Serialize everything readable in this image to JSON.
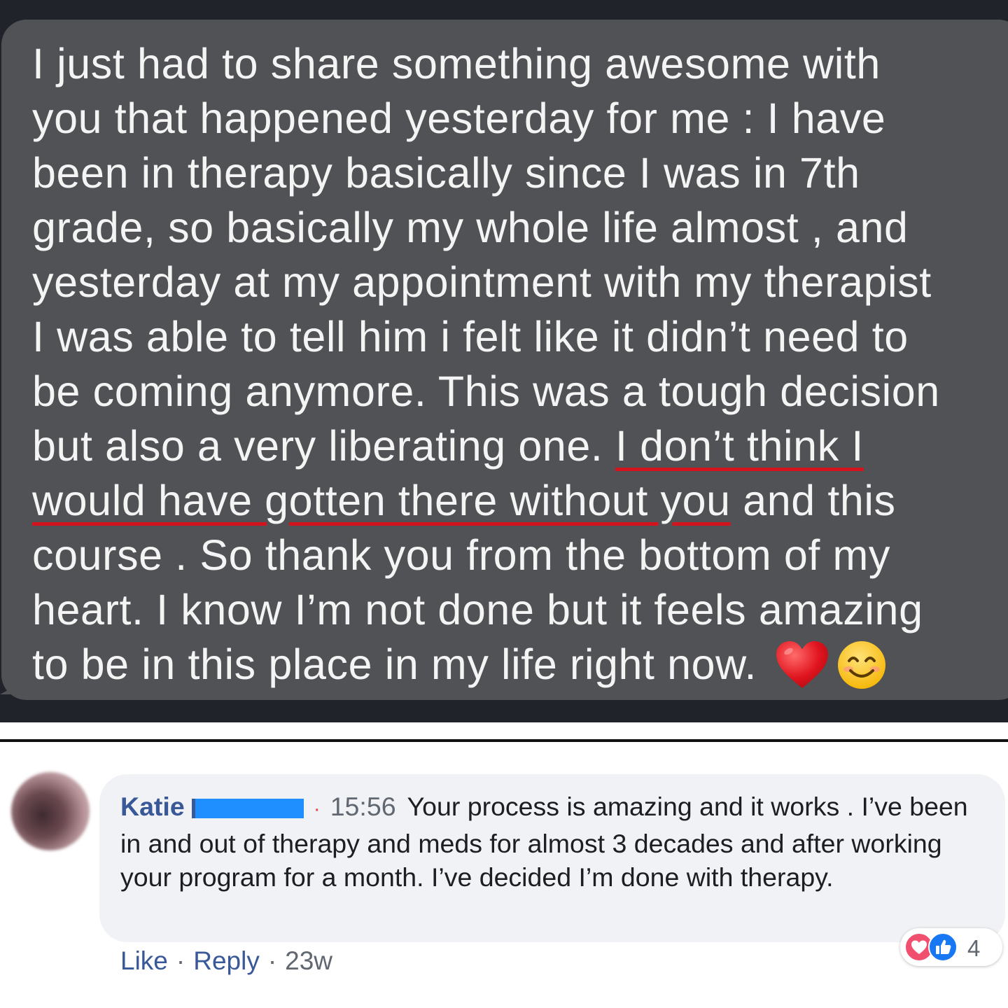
{
  "message": {
    "lines": [
      {
        "pre": "I just had to share something awesome with",
        "hl": "",
        "post": ""
      },
      {
        "pre": "you that happened yesterday for me : I have",
        "hl": "",
        "post": ""
      },
      {
        "pre": "been in therapy basically since I was in 7th",
        "hl": "",
        "post": ""
      },
      {
        "pre": "grade, so basically my whole life almost , and",
        "hl": "",
        "post": ""
      },
      {
        "pre": "yesterday at my appointment with my therapist",
        "hl": "",
        "post": ""
      },
      {
        "pre": "I was able to tell him i felt like it didn’t need to",
        "hl": "",
        "post": ""
      },
      {
        "pre": "be coming anymore. This was a tough decision",
        "hl": "",
        "post": ""
      },
      {
        "pre": "but also a very liberating one. ",
        "hl": "I don’t think I",
        "post": ""
      },
      {
        "pre": "",
        "hl": "would have gotten there without you",
        "post": " and this"
      },
      {
        "pre": "course . So thank you from the bottom of my",
        "hl": "",
        "post": ""
      },
      {
        "pre": "heart. I know I’m not done but it feels amazing",
        "hl": "",
        "post": ""
      },
      {
        "pre": "to be in this place in my life right now.",
        "hl": "",
        "post": ""
      }
    ],
    "emojis": [
      "heart-emoji",
      "smiling-face-emoji"
    ],
    "highlight_color": "#d3141e"
  },
  "comment": {
    "author": "Katie",
    "time": "15:56",
    "text": "Your process is amazing and it works . I’ve been in and out of therapy and meds for almost 3 decades and after working your program for a month. I’ve decided I’m done with therapy.",
    "reactions": {
      "icons": [
        "love-icon",
        "like-icon"
      ],
      "count": "4"
    },
    "actions": {
      "like": "Like",
      "reply": "Reply",
      "age": "23w",
      "separator": "·"
    }
  },
  "colors": {
    "panel": "#20232a",
    "bubble": "#515255",
    "link": "#385898",
    "comment_bg": "#f0f2f5"
  }
}
